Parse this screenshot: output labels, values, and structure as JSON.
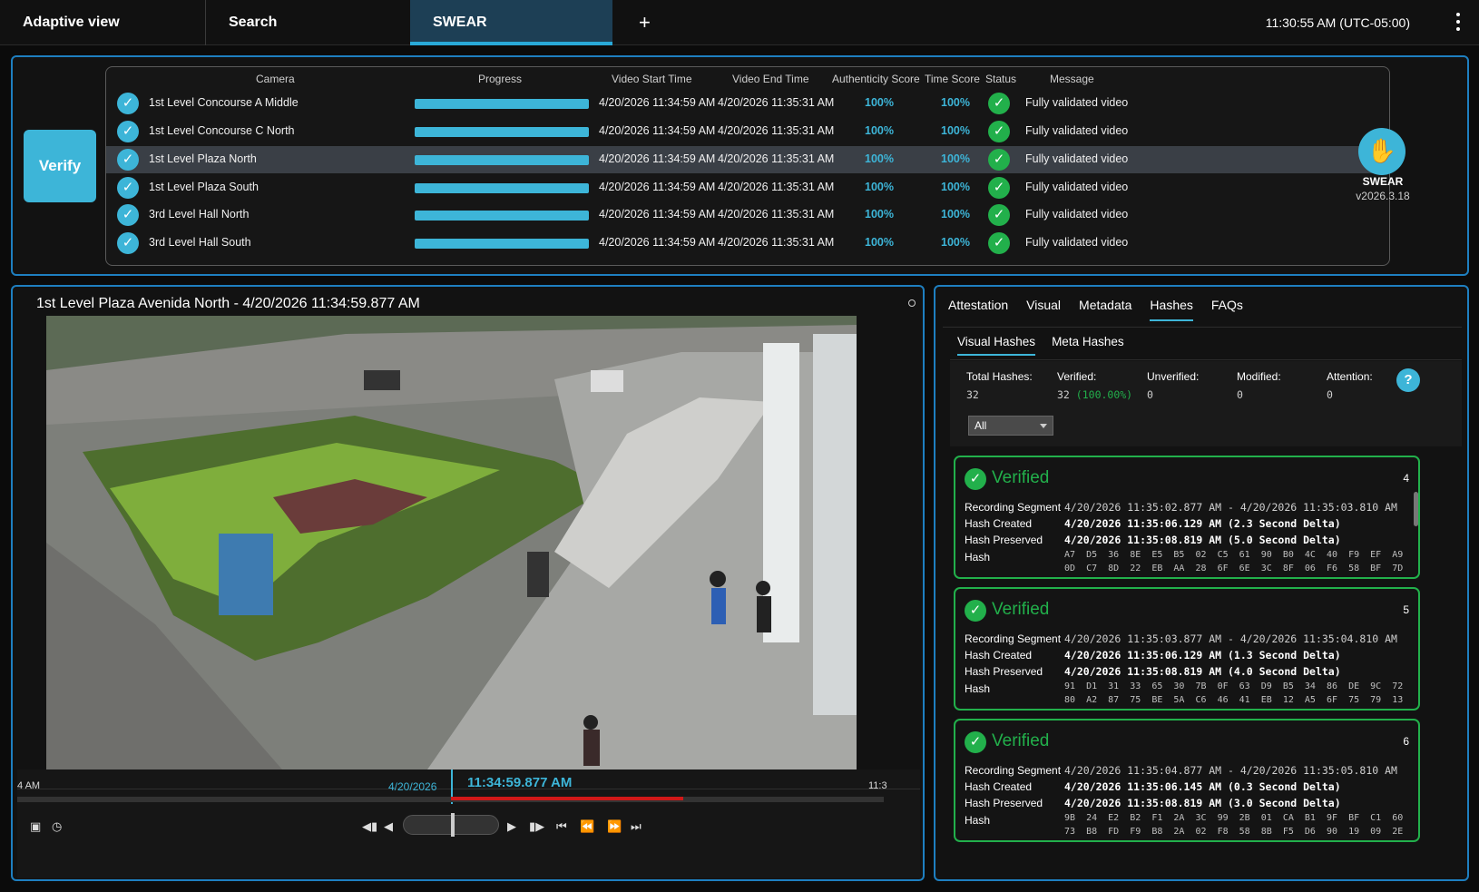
{
  "topbar": {
    "tabs": [
      "Adaptive view",
      "Search",
      "SWEAR"
    ],
    "add_tab": "+",
    "clock": "11:30:55 AM (UTC-05:00)"
  },
  "verify": {
    "button": "Verify"
  },
  "table": {
    "headers": [
      "Camera",
      "Progress",
      "Video Start Time",
      "Video End Time",
      "Authenticity Score",
      "Time Score",
      "Status",
      "Message"
    ],
    "rows": [
      {
        "camera": "1st Level Concourse A Middle",
        "progress": 1.0,
        "start": "4/20/2026 11:34:59 AM",
        "end": "4/20/2026 11:35:31 AM",
        "auth": "100%",
        "time": "100%",
        "message": "Fully validated video"
      },
      {
        "camera": "1st Level Concourse C North",
        "progress": 1.0,
        "start": "4/20/2026 11:34:59 AM",
        "end": "4/20/2026 11:35:31 AM",
        "auth": "100%",
        "time": "100%",
        "message": "Fully validated video"
      },
      {
        "camera": "1st Level Plaza North",
        "progress": 1.0,
        "start": "4/20/2026 11:34:59 AM",
        "end": "4/20/2026 11:35:31 AM",
        "auth": "100%",
        "time": "100%",
        "message": "Fully validated video"
      },
      {
        "camera": "1st Level Plaza South",
        "progress": 1.0,
        "start": "4/20/2026 11:34:59 AM",
        "end": "4/20/2026 11:35:31 AM",
        "auth": "100%",
        "time": "100%",
        "message": "Fully validated video"
      },
      {
        "camera": "3rd Level Hall North",
        "progress": 1.0,
        "start": "4/20/2026 11:34:59 AM",
        "end": "4/20/2026 11:35:31 AM",
        "auth": "100%",
        "time": "100%",
        "message": "Fully validated video"
      },
      {
        "camera": "3rd Level Hall South",
        "progress": 1.0,
        "start": "4/20/2026 11:34:59 AM",
        "end": "4/20/2026 11:35:31 AM",
        "auth": "100%",
        "time": "100%",
        "message": "Fully validated video"
      }
    ],
    "selected_index": 2
  },
  "brand": {
    "name": "SWEAR",
    "version": "v2026.3.18",
    "icon": "hand-icon"
  },
  "video": {
    "title": "1st Level Plaza Avenida North - 4/20/2026 11:34:59.877 AM",
    "timeline_left": "4 AM",
    "timeline_right": "11:3",
    "timeline_date": "4/20/2026",
    "timeline_time": "11:34:59.877 AM"
  },
  "right": {
    "tabs": [
      "Attestation",
      "Visual",
      "Metadata",
      "Hashes",
      "FAQs"
    ],
    "active_tab": "Hashes",
    "subtabs": [
      "Visual Hashes",
      "Meta Hashes"
    ],
    "stats": {
      "total_label": "Total Hashes:",
      "total": "32",
      "verified_label": "Verified:",
      "verified": "32",
      "verified_pct": "(100.00%)",
      "unverified_label": "Unverified:",
      "unverified": "0",
      "modified_label": "Modified:",
      "modified": "0",
      "attention_label": "Attention:",
      "attention": "0"
    },
    "filter": "All",
    "help": "?",
    "labels": {
      "segment": "Recording Segment",
      "created": "Hash Created",
      "preserved": "Hash Preserved",
      "hash": "Hash"
    },
    "cards": [
      {
        "status": "Verified",
        "num": "4",
        "segment": "4/20/2026 11:35:02.877 AM - 4/20/2026 11:35:03.810 AM",
        "created": "4/20/2026 11:35:06.129 AM (2.3 Second Delta)",
        "preserved": "4/20/2026 11:35:08.819 AM (5.0 Second Delta)",
        "hash1": "A7  D5  36  8E  E5  B5  02  C5  61  90  B0  4C  40  F9  EF  A9",
        "hash2": "0D  C7  8D  22  EB  AA  28  6F  6E  3C  8F  06  F6  58  BF  7D"
      },
      {
        "status": "Verified",
        "num": "5",
        "segment": "4/20/2026 11:35:03.877 AM - 4/20/2026 11:35:04.810 AM",
        "created": "4/20/2026 11:35:06.129 AM (1.3 Second Delta)",
        "preserved": "4/20/2026 11:35:08.819 AM (4.0 Second Delta)",
        "hash1": "91  D1  31  33  65  30  7B  0F  63  D9  B5  34  86  DE  9C  72",
        "hash2": "80  A2  87  75  BE  5A  C6  46  41  EB  12  A5  6F  75  79  13"
      },
      {
        "status": "Verified",
        "num": "6",
        "segment": "4/20/2026 11:35:04.877 AM - 4/20/2026 11:35:05.810 AM",
        "created": "4/20/2026 11:35:06.145 AM (0.3 Second Delta)",
        "preserved": "4/20/2026 11:35:08.819 AM (3.0 Second Delta)",
        "hash1": "9B  24  E2  B2  F1  2A  3C  99  2B  01  CA  B1  9F  BF  C1  60",
        "hash2": "73  B8  FD  F9  B8  2A  02  F8  58  8B  F5  D6  90  19  09  2E"
      }
    ]
  },
  "colors": {
    "accent": "#3db5d8",
    "success": "#22b04b",
    "panel_border": "#1e7fc0"
  }
}
